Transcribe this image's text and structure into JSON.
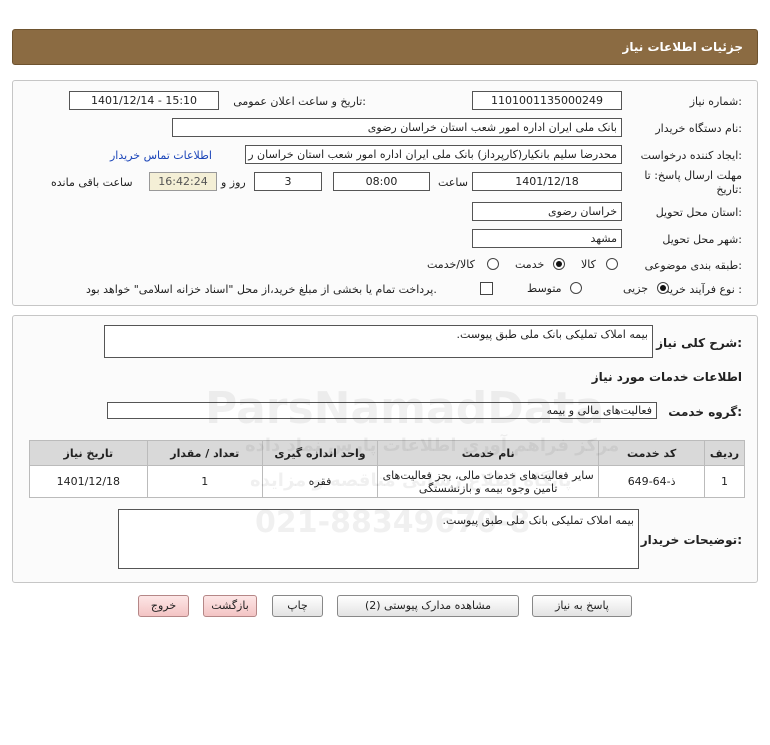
{
  "header": {
    "title": "جزئیات اطلاعات نیاز"
  },
  "form": {
    "need_number_label": "شماره نیاز:",
    "need_number": "1101001135000249",
    "announce_label": "تاریخ و ساعت اعلان عمومی:",
    "announce_value": "1401/12/14 - 15:10",
    "buyer_org_label": "نام دستگاه خریدار:",
    "buyer_org": "بانک ملی ایران اداره امور شعب استان خراسان رضوی",
    "requester_label": "ایجاد کننده درخواست:",
    "requester": "محدرضا سلیم  بانکیار(کارپرداز) بانک ملی ایران اداره امور شعب استان خراسان ر",
    "contact_link": "اطلاعات تماس خریدار",
    "deadline_label": "مهلت ارسال پاسخ: تا تاریخ:",
    "deadline_date": "1401/12/18",
    "time_label": "ساعت",
    "deadline_time": "08:00",
    "days_value": "3",
    "days_label": "روز و",
    "remaining_time": "16:42:24",
    "remaining_label": "ساعت باقی مانده",
    "province_label": "استان محل تحویل:",
    "province": "خراسان رضوی",
    "city_label": "شهر محل تحویل:",
    "city": "مشهد",
    "category_label": "طبقه بندی موضوعی:",
    "category_options": [
      "کالا",
      "خدمت",
      "کالا/خدمت"
    ],
    "category_selected": "خدمت",
    "process_label": "نوع فرآیند خرید :",
    "process_options": [
      "جزیی",
      "متوسط"
    ],
    "process_selected": "جزیی",
    "payment_note": "پرداخت تمام یا بخشی از مبلغ خرید،از محل \"اسناد خزانه اسلامی\" خواهد بود."
  },
  "summary": {
    "label": "شرح کلی نیاز:",
    "value": "بیمه املاک تملیکی بانک ملی طبق پیوست."
  },
  "services": {
    "section_title": "اطلاعات خدمات مورد نیاز",
    "group_label": "گروه خدمت:",
    "group_value": "فعالیت‌های مالی و بیمه",
    "columns": [
      "ردیف",
      "کد خدمت",
      "نام خدمت",
      "واحد اندازه گیری",
      "تعداد / مقدار",
      "تاریخ نیاز"
    ],
    "rows": [
      {
        "row": "1",
        "code": "ذ-64-649",
        "name": "سایر فعالیت‌های خدمات مالی، بجز فعالیت‌های تامین وجوه بیمه و بازنشستگی",
        "unit": "فقره",
        "qty": "1",
        "date": "1401/12/18"
      }
    ]
  },
  "buyer_notes": {
    "label": "توضیحات خریدار:",
    "value": "بیمه املاک تملیکی بانک ملی طبق پیوست."
  },
  "buttons": {
    "reply": "پاسخ به نیاز",
    "view_docs": "مشاهده مدارک پیوستی (2)",
    "print": "چاپ",
    "back": "بازگشت",
    "exit": "خروج"
  },
  "watermark": {
    "brand": "ParsNamadData",
    "line1": "مرکز فراهم آوری اطلاعات پارس نماد داده",
    "line2": "پایگاه اطلاع رسانی مناقصه و مزایده",
    "phone": "021-88349670-8"
  },
  "colors": {
    "header_bg": "#8b6b42",
    "link": "#1a44b8",
    "exit_button": "#f3c4c4"
  }
}
